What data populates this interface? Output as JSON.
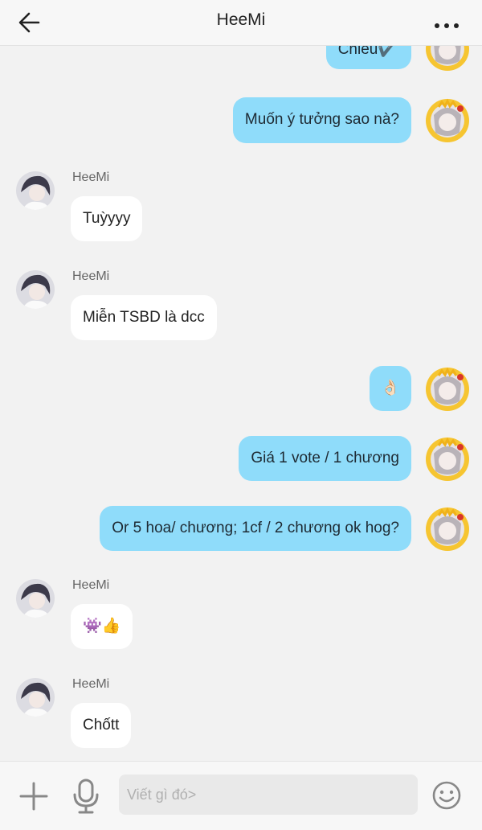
{
  "header": {
    "title": "HeeMi",
    "back_icon": "arrow-left-icon",
    "more_icon": "more-dots-icon"
  },
  "colors": {
    "outgoing_bubble": "#8fdcfa",
    "incoming_bubble": "#ffffff",
    "background": "#f2f2f2"
  },
  "messages": [
    {
      "direction": "out",
      "text": "Chiều✔️",
      "emoji": false
    },
    {
      "direction": "out",
      "text": "Muốn ý tưởng sao nà?",
      "emoji": false
    },
    {
      "direction": "in",
      "sender": "HeeMi",
      "text": "Tuỳyyy",
      "emoji": false
    },
    {
      "direction": "in",
      "sender": "HeeMi",
      "text": "Miễn TSBD là dcc",
      "emoji": false
    },
    {
      "direction": "out",
      "text": "👌🏻",
      "emoji": true
    },
    {
      "direction": "out",
      "text": "Giá 1 vote / 1 chương",
      "emoji": false
    },
    {
      "direction": "out",
      "text": "Or 5 hoa/ chương; 1cf / 2 chương ok hog?",
      "emoji": false
    },
    {
      "direction": "in",
      "sender": "HeeMi",
      "text": "👾👍",
      "emoji": true
    },
    {
      "direction": "in",
      "sender": "HeeMi",
      "text": "Chốtt",
      "emoji": false
    }
  ],
  "composer": {
    "plus_icon": "plus-icon",
    "mic_icon": "microphone-icon",
    "emoji_icon": "smiley-icon",
    "placeholder": "Viết gì đó>",
    "value": ""
  }
}
